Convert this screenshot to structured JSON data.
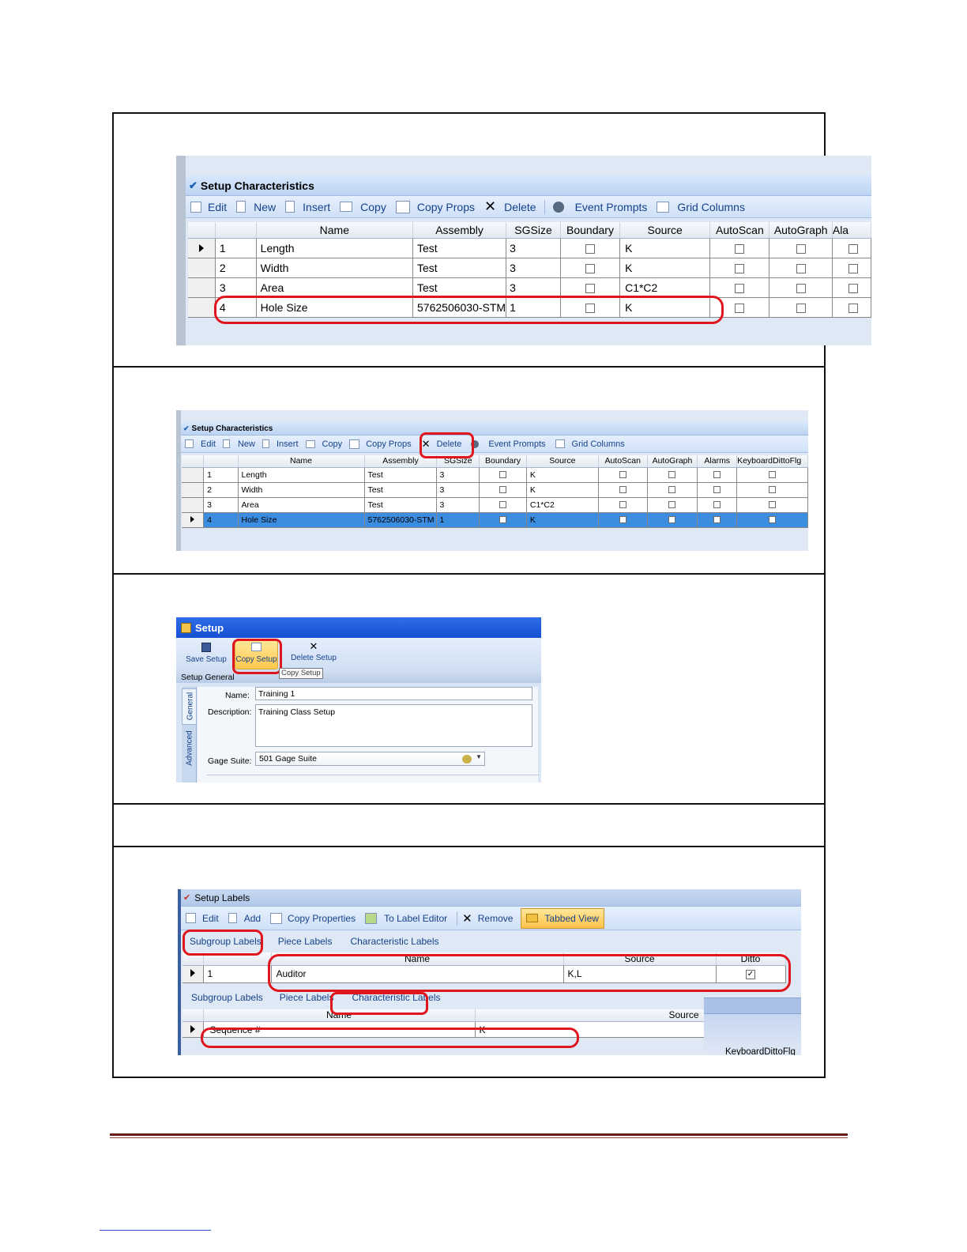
{
  "grid1": {
    "title": "Setup Characteristics",
    "toolbar": {
      "edit": "Edit",
      "new": "New",
      "insert": "Insert",
      "copy": "Copy",
      "copy_props": "Copy Props",
      "delete": "Delete",
      "event_prompts": "Event Prompts",
      "grid_columns": "Grid Columns"
    },
    "columns": [
      "Name",
      "Assembly",
      "SGSize",
      "Boundary",
      "Source",
      "AutoScan",
      "AutoGraph",
      "Ala"
    ],
    "rows": [
      {
        "num": "1",
        "name": "Length",
        "assembly": "Test",
        "sgsize": "3",
        "source": "K"
      },
      {
        "num": "2",
        "name": "Width",
        "assembly": "Test",
        "sgsize": "3",
        "source": "K"
      },
      {
        "num": "3",
        "name": "Area",
        "assembly": "Test",
        "sgsize": "3",
        "source": "C1*C2"
      },
      {
        "num": "4",
        "name": "Hole Size",
        "assembly": "5762506030-STM",
        "sgsize": "1",
        "source": "K"
      }
    ]
  },
  "grid2": {
    "title": "Setup Characteristics",
    "toolbar": {
      "edit": "Edit",
      "new": "New",
      "insert": "Insert",
      "copy": "Copy",
      "copy_props": "Copy Props",
      "delete": "Delete",
      "event_prompts": "Event Prompts",
      "grid_columns": "Grid Columns"
    },
    "columns": [
      "Name",
      "Assembly",
      "SGSize",
      "Boundary",
      "Source",
      "AutoScan",
      "AutoGraph",
      "Alarms",
      "KeyboardDittoFlg"
    ],
    "rows": [
      {
        "num": "1",
        "name": "Length",
        "assembly": "Test",
        "sgsize": "3",
        "source": "K"
      },
      {
        "num": "2",
        "name": "Width",
        "assembly": "Test",
        "sgsize": "3",
        "source": "K"
      },
      {
        "num": "3",
        "name": "Area",
        "assembly": "Test",
        "sgsize": "3",
        "source": "C1*C2"
      },
      {
        "num": "4",
        "name": "Hole Size",
        "assembly": "5762506030-STM",
        "sgsize": "1",
        "source": "K"
      }
    ]
  },
  "setup": {
    "title": "Setup",
    "save_setup": "Save Setup",
    "copy_setup": "Copy Setup",
    "delete_setup": "Delete Setup",
    "tooltip": "Copy Setup",
    "group_label": "Setup General",
    "tab_general": "General",
    "tab_advanced": "Advanced",
    "name_label": "Name:",
    "name_value": "Training 1",
    "description_label": "Description:",
    "description_value": "Training Class Setup",
    "gage_suite_label": "Gage Suite:",
    "gage_suite_value": "501 Gage Suite"
  },
  "labels": {
    "title": "Setup Labels",
    "toolbar": {
      "edit": "Edit",
      "add": "Add",
      "copy_properties": "Copy Properties",
      "to_label_editor": "To Label Editor",
      "remove": "Remove",
      "tabbed_view": "Tabbed View"
    },
    "tabs_top": [
      "Subgroup Labels",
      "Piece Labels",
      "Characteristic Labels"
    ],
    "grid_top": {
      "columns": [
        "Name",
        "Source",
        "Ditto"
      ],
      "row": {
        "num": "1",
        "name": "Auditor",
        "source": "K,L"
      }
    },
    "tabs_bottom": [
      "Subgroup Labels",
      "Piece Labels",
      "Characteristic Labels"
    ],
    "grid_bottom": {
      "columns": [
        "Name",
        "Source"
      ],
      "row": {
        "name": "Sequence #",
        "source": "K"
      }
    },
    "cutoff_text": "KeyboardDittoFlg"
  }
}
